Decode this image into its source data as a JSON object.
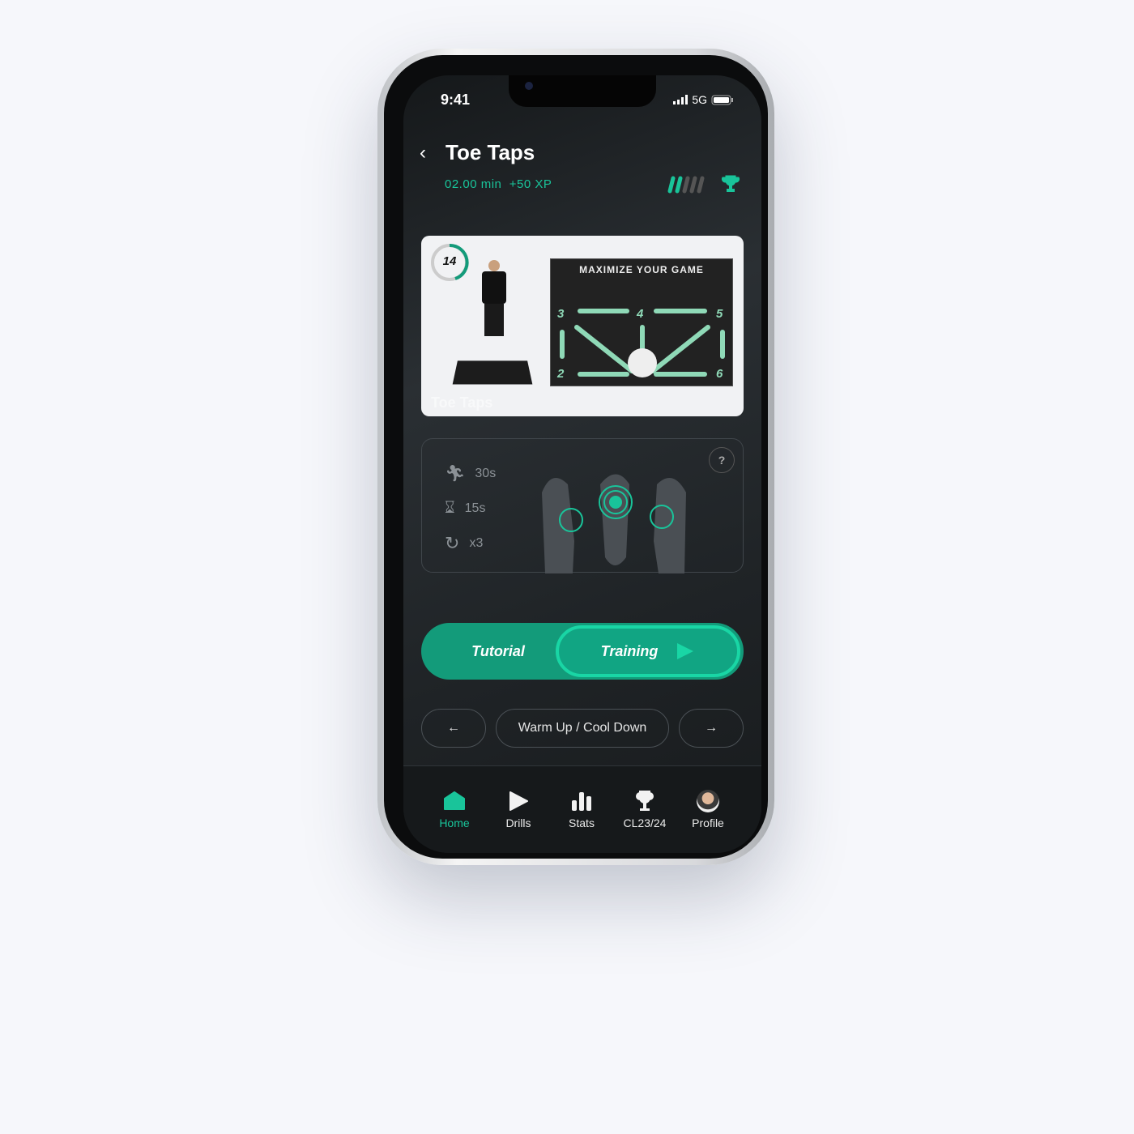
{
  "status_bar": {
    "time": "9:41",
    "network": "5G"
  },
  "header": {
    "title": "Toe Taps",
    "duration": "02.00 min",
    "xp": "+50 XP",
    "difficulty_level": 2,
    "difficulty_max": 5
  },
  "video": {
    "countdown": "14",
    "board_title": "MAXIMIZE YOUR GAME",
    "board_numbers": [
      "3",
      "4",
      "5",
      "2",
      "6"
    ],
    "caption": "Toe Taps"
  },
  "drill_info": {
    "work": "30s",
    "rest": "15s",
    "repeats": "x3",
    "help": "?"
  },
  "actions": {
    "tutorial": "Tutorial",
    "training": "Training"
  },
  "category_nav": {
    "current": "Warm Up / Cool Down"
  },
  "bottom_nav": [
    {
      "label": "Home",
      "active": true
    },
    {
      "label": "Drills"
    },
    {
      "label": "Stats"
    },
    {
      "label": "CL23/24"
    },
    {
      "label": "Profile"
    }
  ],
  "colors": {
    "accent": "#19c49a",
    "button": "#139b7a",
    "background": "#1f2326"
  }
}
